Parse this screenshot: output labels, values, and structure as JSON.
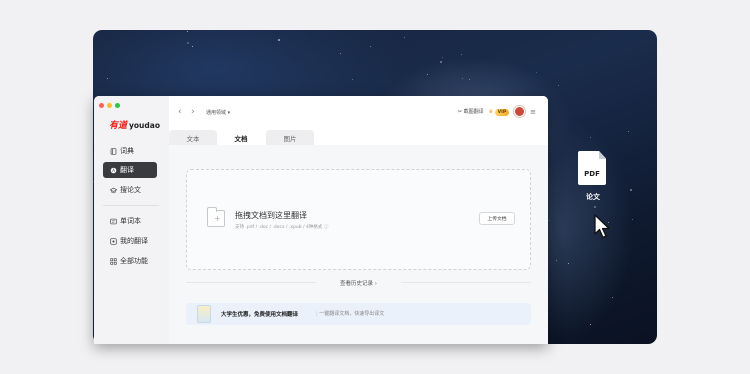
{
  "brand": {
    "logo_cn": "有道",
    "logo_en": "youdao"
  },
  "sidebar": {
    "items": [
      {
        "label": "词典",
        "icon": "book-icon",
        "active": false
      },
      {
        "label": "翻译",
        "icon": "translate-icon",
        "active": true
      },
      {
        "label": "搜论文",
        "icon": "graduation-cap-icon",
        "active": false
      },
      {
        "label": "单词本",
        "icon": "wordbook-icon",
        "active": false
      },
      {
        "label": "我的翻译",
        "icon": "my-translation-icon",
        "active": false
      },
      {
        "label": "全部功能",
        "icon": "grid-icon",
        "active": false
      }
    ]
  },
  "topbar": {
    "domain_label": "通用领域",
    "screenshot_translate": "截图翻译",
    "vip": "VIP"
  },
  "tabs": [
    {
      "label": "文本",
      "active": false
    },
    {
      "label": "文档",
      "active": true
    },
    {
      "label": "图片",
      "active": false
    }
  ],
  "dropzone": {
    "title": "拖拽文档到这里翻译",
    "subtitle": "支持 .pdf / .doc / .docx / .xpub / 4种格式",
    "upload_label": "上传文档"
  },
  "history_label": "查看历史记录",
  "promo": {
    "title": "大学生优惠，免费使用文档翻译",
    "subtitle": "一键翻译文档，快速导出译文"
  },
  "desktop_file": {
    "badge": "PDF",
    "name": "论文"
  },
  "colors": {
    "accent_red": "#e2231a",
    "active_nav_bg": "#3a3b3f",
    "promo_bg": "#eaf1fb"
  }
}
